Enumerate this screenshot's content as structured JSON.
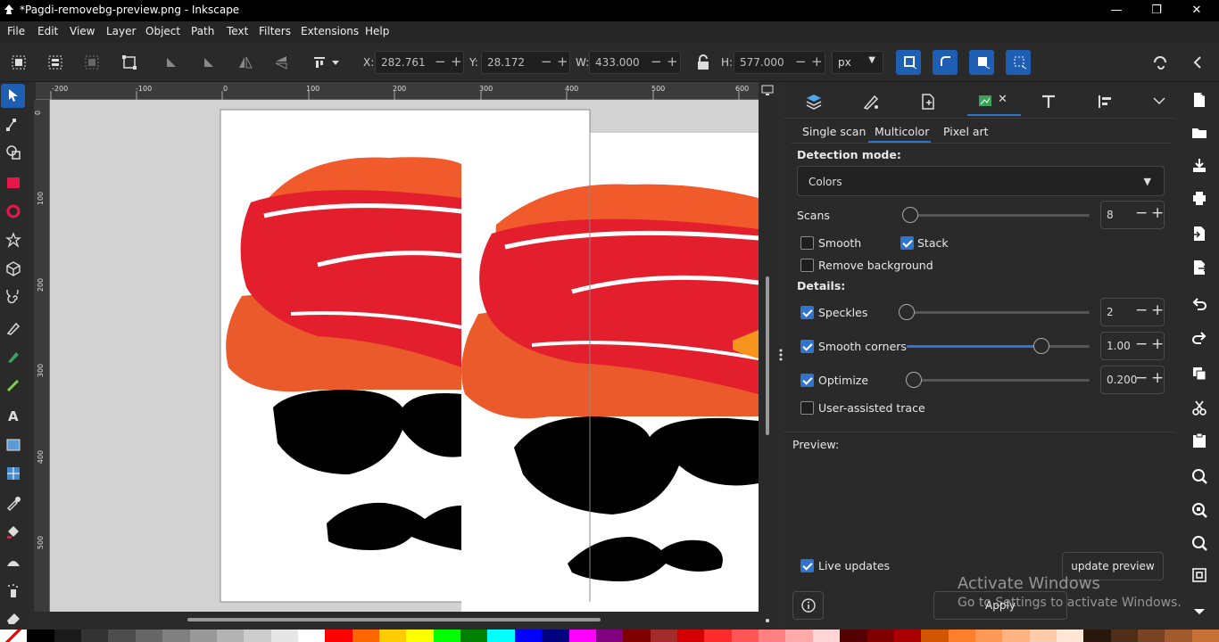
{
  "window": {
    "title": "*Pagdi-removebg-preview.png - Inkscape",
    "minimize": "—",
    "maximize": "❐",
    "close": "✕"
  },
  "menu": [
    "File",
    "Edit",
    "View",
    "Layer",
    "Object",
    "Path",
    "Text",
    "Filters",
    "Extensions",
    "Help"
  ],
  "coords": {
    "x_label": "X:",
    "x": "282.761",
    "y_label": "Y:",
    "y": "28.172",
    "w_label": "W:",
    "w": "433.000",
    "h_label": "H:",
    "h": "577.000",
    "unit": "px"
  },
  "ruler": {
    "h_ticks": [
      "-200",
      "-100",
      "0",
      "100",
      "200",
      "300",
      "400",
      "500",
      "600"
    ],
    "v_ticks": [
      "0",
      "100",
      "200",
      "300",
      "400",
      "500"
    ]
  },
  "trace": {
    "tabs": [
      "Single scan",
      "Multicolor",
      "Pixel art"
    ],
    "active_tab": "Multicolor",
    "detection_mode_label": "Detection mode:",
    "detection_mode": "Colors",
    "scans_label": "Scans",
    "scans": "8",
    "smooth_label": "Smooth",
    "stack_label": "Stack",
    "remove_bg_label": "Remove background",
    "details_label": "Details:",
    "speckles_label": "Speckles",
    "speckles": "2",
    "smooth_corners_label": "Smooth corners",
    "smooth_corners": "1.00",
    "optimize_label": "Optimize",
    "optimize": "0.200",
    "user_assisted_label": "User-assisted trace",
    "preview_label": "Preview:",
    "live_updates_label": "Live updates",
    "update_preview_label": "update preview",
    "apply_label": "Apply"
  },
  "watermark": {
    "line1": "Activate Windows",
    "line2": "Go to Settings to activate Windows."
  },
  "palette": [
    "#000000",
    "#1a1a1a",
    "#333333",
    "#4d4d4d",
    "#666666",
    "#808080",
    "#999999",
    "#b3b3b3",
    "#cccccc",
    "#e6e6e6",
    "#ffffff",
    "#ff0000",
    "#ff6600",
    "#ffcc00",
    "#ffff00",
    "#00ff00",
    "#008000",
    "#00ffff",
    "#0000ff",
    "#000080",
    "#ff00ff",
    "#800080",
    "#800000",
    "#a52a2a",
    "#d40000",
    "#ff2a2a",
    "#ff5555",
    "#ff8080",
    "#ffaaaa",
    "#ffd5d5",
    "#550000",
    "#800000",
    "#aa0000",
    "#d45500",
    "#ff7f2a",
    "#ff9955",
    "#ffb380",
    "#ffccaa",
    "#ffe6d5",
    "#28170b",
    "#502d16",
    "#784421",
    "#a05a2c",
    "#c87137"
  ]
}
